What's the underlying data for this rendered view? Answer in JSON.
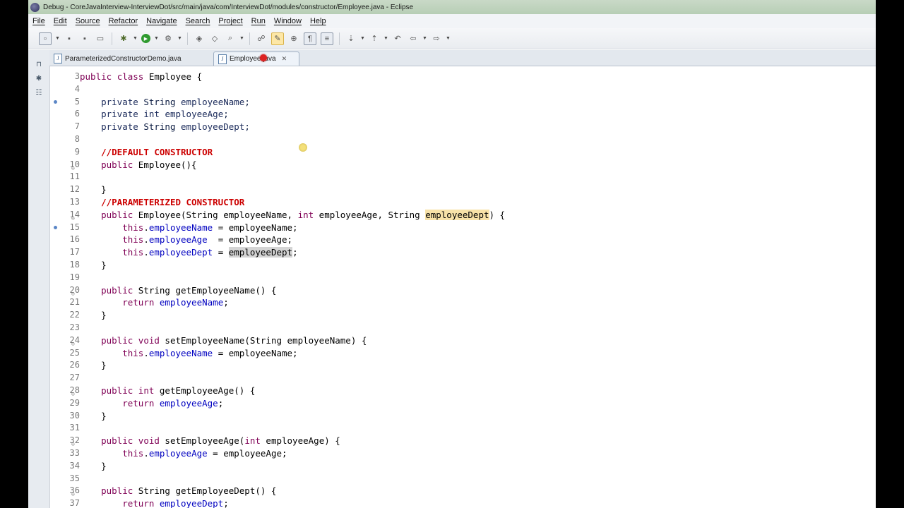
{
  "titlebar": {
    "title": "Debug - CoreJavaInterview-InterviewDot/src/main/java/com/InterviewDot/modules/constructor/Employee.java - Eclipse"
  },
  "menu": {
    "items": [
      "File",
      "Edit",
      "Source",
      "Refactor",
      "Navigate",
      "Search",
      "Project",
      "Run",
      "Window",
      "Help"
    ]
  },
  "tabs": [
    {
      "label": "ParameterizedConstructorDemo.java",
      "active": false
    },
    {
      "label": "Employee.java",
      "active": true
    }
  ],
  "editor": {
    "lines": [
      {
        "n": "3",
        "text": "public class Employee {"
      },
      {
        "n": "4",
        "text": ""
      },
      {
        "n": "5",
        "text": "    private String employeeName;"
      },
      {
        "n": "6",
        "text": "    private int employeeAge;"
      },
      {
        "n": "7",
        "text": "    private String employeeDept;"
      },
      {
        "n": "8",
        "text": ""
      },
      {
        "n": "9",
        "text": "    //DEFAULT CONSTRUCTOR"
      },
      {
        "n": "10",
        "text": "    public Employee(){"
      },
      {
        "n": "11",
        "text": ""
      },
      {
        "n": "12",
        "text": "    }"
      },
      {
        "n": "13",
        "text": "    //PARAMETERIZED CONSTRUCTOR"
      },
      {
        "n": "14",
        "text": "    public Employee(String employeeName, int employeeAge, String employeeDept) {"
      },
      {
        "n": "15",
        "text": "        this.employeeName = employeeName;"
      },
      {
        "n": "16",
        "text": "        this.employeeAge  = employeeAge;"
      },
      {
        "n": "17",
        "text": "        this.employeeDept = employeeDept;"
      },
      {
        "n": "18",
        "text": "    }"
      },
      {
        "n": "19",
        "text": ""
      },
      {
        "n": "20",
        "text": "    public String getEmployeeName() {"
      },
      {
        "n": "21",
        "text": "        return employeeName;"
      },
      {
        "n": "22",
        "text": "    }"
      },
      {
        "n": "23",
        "text": ""
      },
      {
        "n": "24",
        "text": "    public void setEmployeeName(String employeeName) {"
      },
      {
        "n": "25",
        "text": "        this.employeeName = employeeName;"
      },
      {
        "n": "26",
        "text": "    }"
      },
      {
        "n": "27",
        "text": ""
      },
      {
        "n": "28",
        "text": "    public int getEmployeeAge() {"
      },
      {
        "n": "29",
        "text": "        return employeeAge;"
      },
      {
        "n": "30",
        "text": "    }"
      },
      {
        "n": "31",
        "text": ""
      },
      {
        "n": "32",
        "text": "    public void setEmployeeAge(int employeeAge) {"
      },
      {
        "n": "33",
        "text": "        this.employeeAge = employeeAge;"
      },
      {
        "n": "34",
        "text": "    }"
      },
      {
        "n": "35",
        "text": ""
      },
      {
        "n": "36",
        "text": "    public String getEmployeeDept() {"
      },
      {
        "n": "37",
        "text": "        return employeeDept;"
      }
    ]
  }
}
